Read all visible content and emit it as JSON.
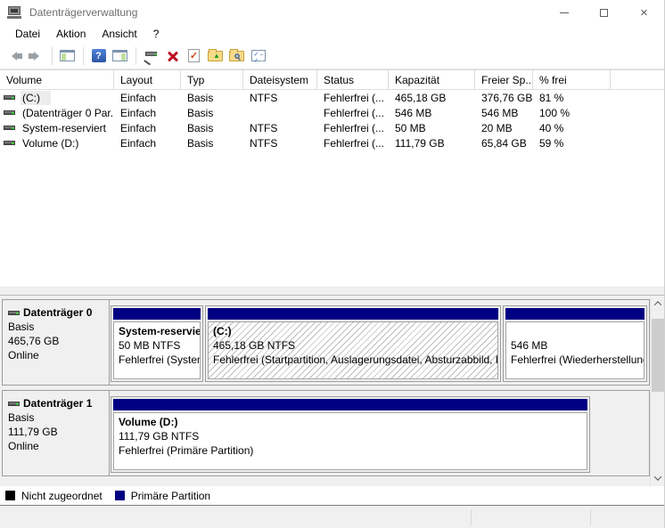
{
  "window": {
    "title": "Datenträgerverwaltung",
    "close_glyph": "×"
  },
  "menu": {
    "items": [
      {
        "label": "Datei"
      },
      {
        "label": "Aktion"
      },
      {
        "label": "Ansicht"
      },
      {
        "label": "?"
      }
    ]
  },
  "toolbar": {
    "help_glyph": "?",
    "mark_glyph": "✓",
    "up_glyph": "▲",
    "check_glyph": "✓",
    "icons": [
      "back-arrow",
      "forward-arrow",
      "show-console-tree",
      "help",
      "show-action-pane",
      "drive-pointer",
      "delete-volume",
      "mark-partition-active",
      "open-folder",
      "explore-folder",
      "properties-list"
    ]
  },
  "volume_table": {
    "columns": [
      {
        "label": "Volume"
      },
      {
        "label": "Layout"
      },
      {
        "label": "Typ"
      },
      {
        "label": "Dateisystem"
      },
      {
        "label": "Status"
      },
      {
        "label": "Kapazität"
      },
      {
        "label": "Freier Sp..."
      },
      {
        "label": "% frei"
      }
    ],
    "rows": [
      {
        "volume": "(C:)",
        "layout": "Einfach",
        "typ": "Basis",
        "dateisystem": "NTFS",
        "status": "Fehlerfrei (...",
        "kapazitaet": "465,18 GB",
        "freier_speicher": "376,76 GB",
        "prozent_frei": "81 %"
      },
      {
        "volume": "(Datenträger 0 Par...",
        "layout": "Einfach",
        "typ": "Basis",
        "dateisystem": "",
        "status": "Fehlerfrei (...",
        "kapazitaet": "546 MB",
        "freier_speicher": "546 MB",
        "prozent_frei": "100 %"
      },
      {
        "volume": "System-reserviert",
        "layout": "Einfach",
        "typ": "Basis",
        "dateisystem": "NTFS",
        "status": "Fehlerfrei (...",
        "kapazitaet": "50 MB",
        "freier_speicher": "20 MB",
        "prozent_frei": "40 %"
      },
      {
        "volume": "Volume (D:)",
        "layout": "Einfach",
        "typ": "Basis",
        "dateisystem": "NTFS",
        "status": "Fehlerfrei (...",
        "kapazitaet": "111,79 GB",
        "freier_speicher": "65,84 GB",
        "prozent_frei": "59 %"
      }
    ]
  },
  "disks": [
    {
      "name": "Datenträger 0",
      "type": "Basis",
      "size": "465,76 GB",
      "status": "Online",
      "partitions": [
        {
          "title": "System-reserviert",
          "line2": "50 MB NTFS",
          "line3": "Fehlerfrei (System"
        },
        {
          "title": "(C:)",
          "line2": "465,18 GB NTFS",
          "line3": "Fehlerfrei (Startpartition, Auslagerungsdatei, Absturzabbild, Pri"
        },
        {
          "title": "",
          "line2": "546 MB",
          "line3": "Fehlerfrei (Wiederherstellungs"
        }
      ]
    },
    {
      "name": "Datenträger 1",
      "type": "Basis",
      "size": "111,79 GB",
      "status": "Online",
      "partitions": [
        {
          "title": "Volume (D:)",
          "line2": "111,79 GB NTFS",
          "line3": "Fehlerfrei (Primäre Partition)"
        }
      ]
    }
  ],
  "legend": [
    {
      "label": "Nicht zugeordnet",
      "color": "#000000"
    },
    {
      "label": "Primäre Partition",
      "color": "#000082"
    }
  ],
  "colors": {
    "primary_partition": "#000082",
    "unallocated": "#000000",
    "pane_background": "#f0f0f0",
    "selection_hatch": "#bdbdbd"
  }
}
